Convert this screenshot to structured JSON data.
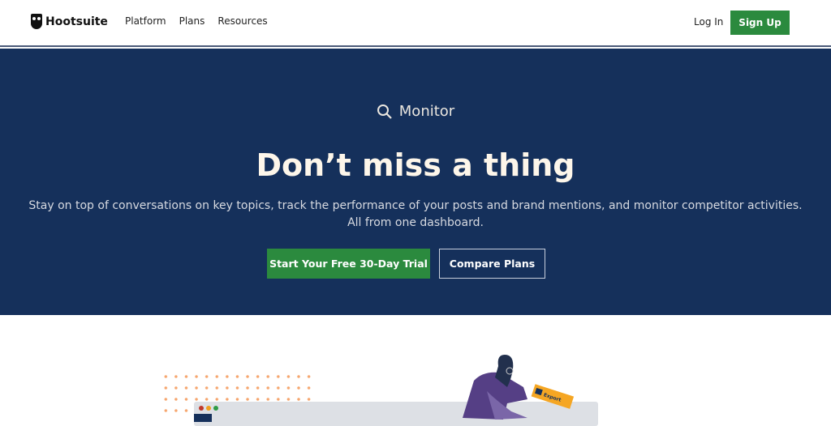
{
  "nav": {
    "brand": "Hootsuite",
    "links": [
      "Platform",
      "Plans",
      "Resources"
    ],
    "login": "Log In",
    "signup": "Sign Up"
  },
  "hero": {
    "eyebrow": "Monitor",
    "title": "Don’t miss a thing",
    "subtitle": "Stay on top of conversations on key topics, track the performance of your posts and brand mentions, and monitor competitor activities. All from one dashboard.",
    "cta_primary": "Start Your Free 30-Day Trial",
    "cta_secondary": "Compare Plans"
  },
  "colors": {
    "navy": "#15305b",
    "green": "#2b8a3e",
    "dots": "#f6a66e"
  },
  "illustration": {
    "export_label": "Export"
  }
}
